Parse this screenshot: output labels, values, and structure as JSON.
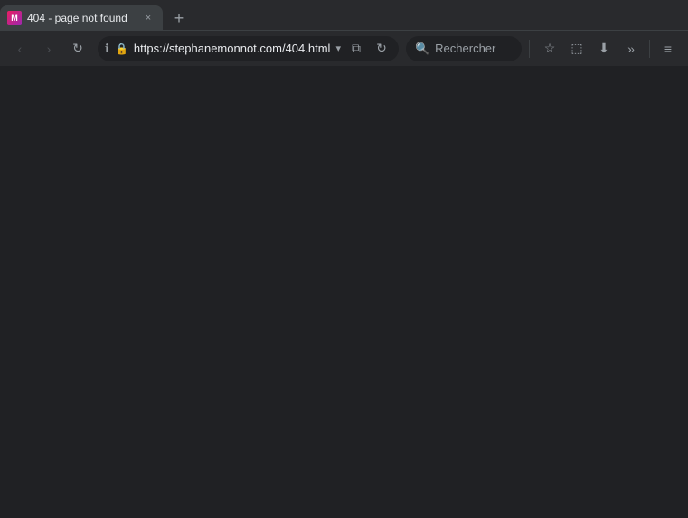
{
  "titlebar": {
    "tab": {
      "favicon_label": "M",
      "title": "404 - page not found",
      "close_label": "×"
    },
    "new_tab_label": "+"
  },
  "toolbar": {
    "back_label": "‹",
    "forward_label": "›",
    "info_label": "ℹ",
    "reload_label": "↻",
    "address": {
      "protocol": "https://",
      "domain": "stephanemonnot",
      "tld_path": ".com/404.html"
    },
    "dropdown_label": "▾",
    "pip_label": "⧉",
    "reload2_label": "↻",
    "search_placeholder": "Rechercher",
    "bookmark_label": "☆",
    "profile_label": "⬚",
    "download_label": "⬇",
    "extension_label": "»",
    "menu_label": "≡"
  }
}
